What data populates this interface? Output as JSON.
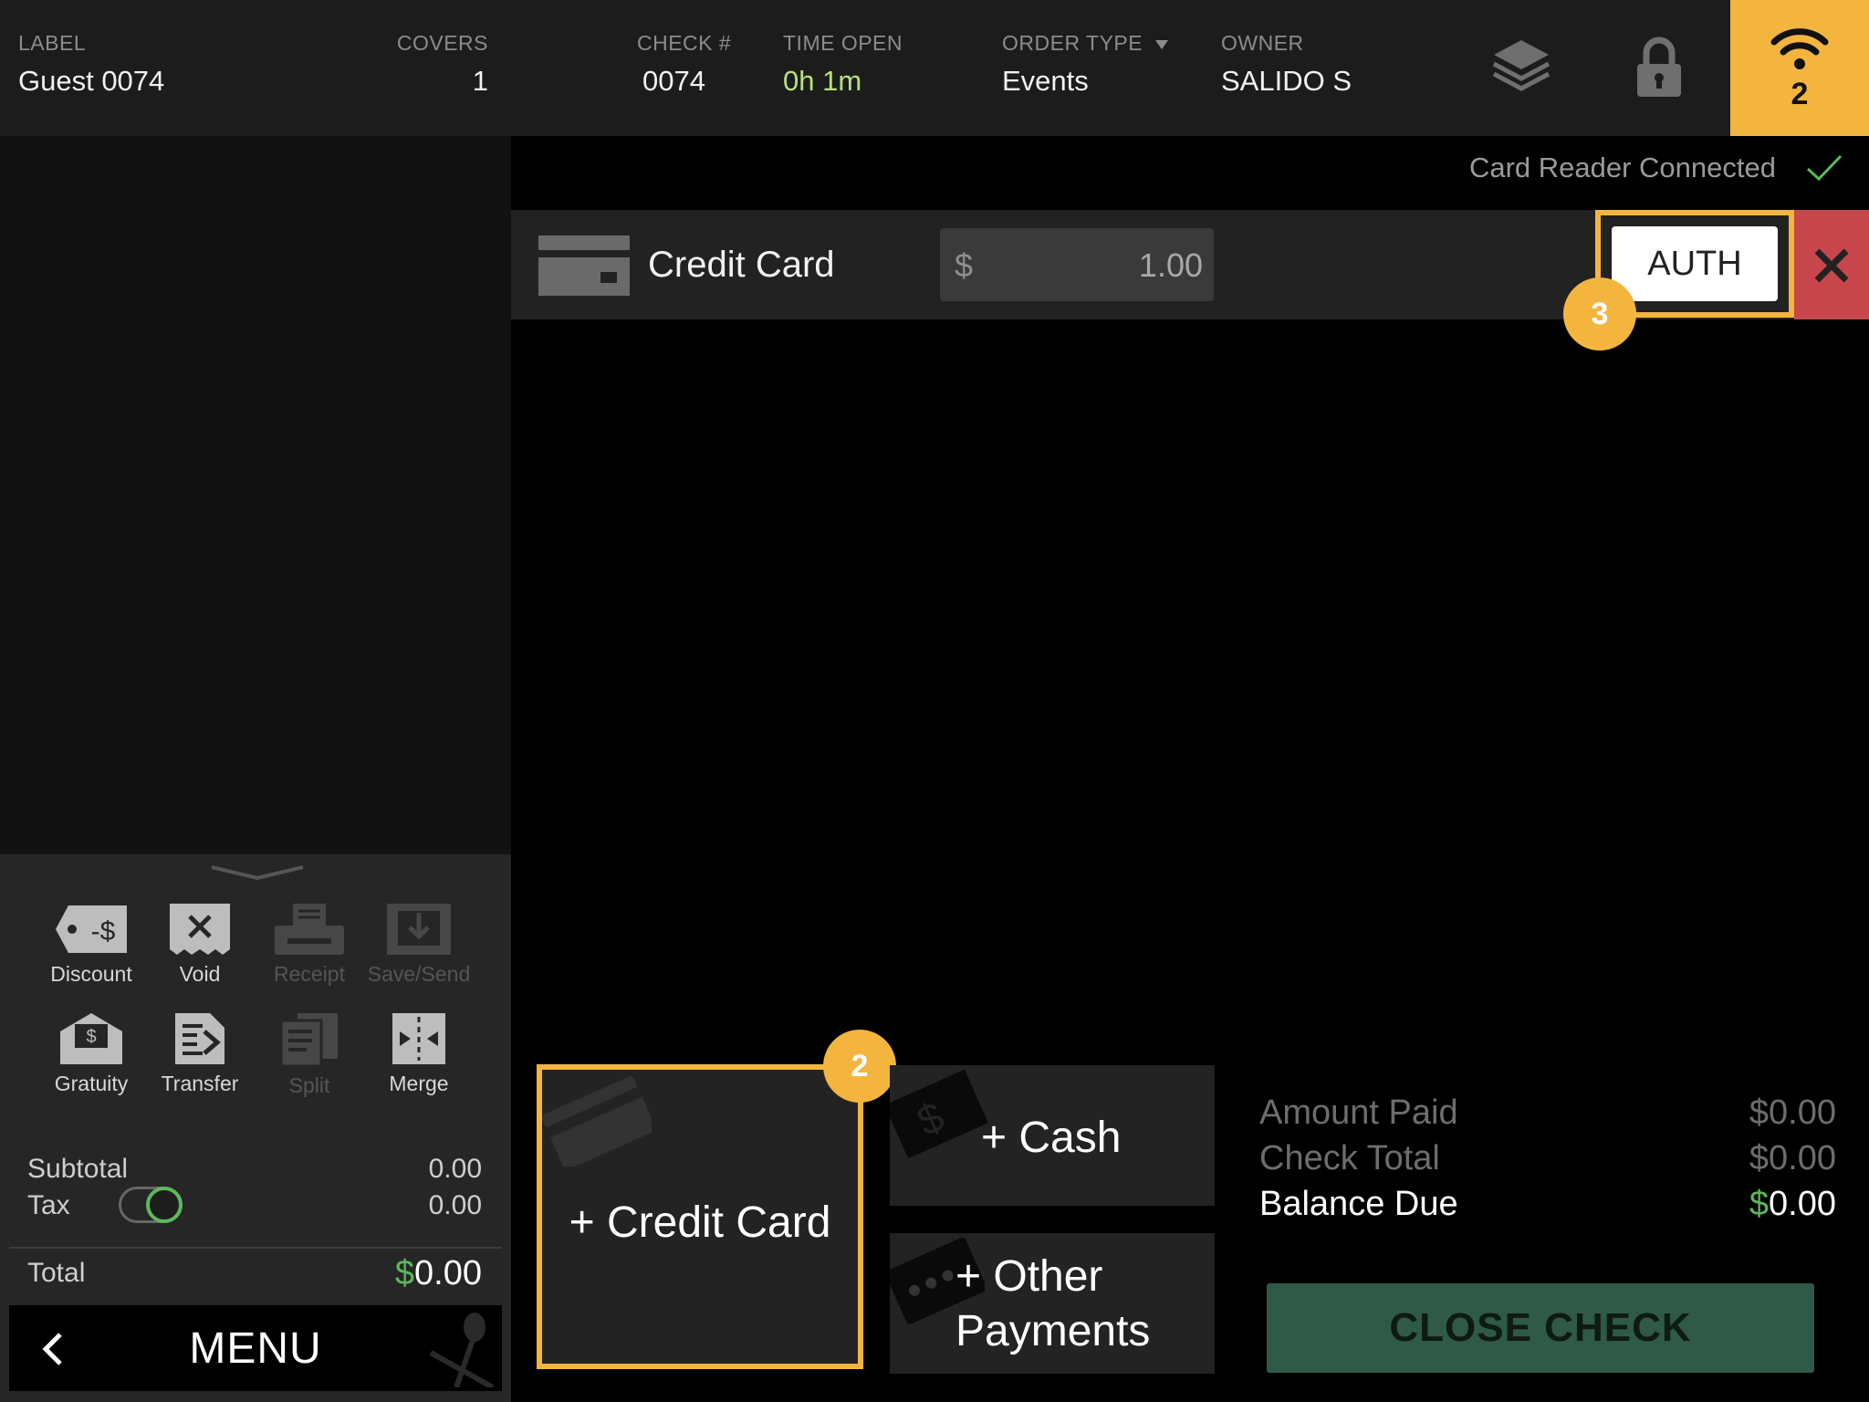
{
  "header": {
    "label": {
      "title": "LABEL",
      "value": "Guest 0074"
    },
    "covers": {
      "title": "COVERS",
      "value": "1"
    },
    "check": {
      "title": "CHECK #",
      "value": "0074"
    },
    "time_open": {
      "title": "TIME OPEN",
      "value": "0h 1m"
    },
    "order_type": {
      "title": "ORDER TYPE",
      "value": "Events"
    },
    "owner": {
      "title": "OWNER",
      "value": "SALIDO S"
    },
    "icons": [
      "layers-icon",
      "lock-icon",
      "wifi-icon"
    ],
    "wifi_count": "2"
  },
  "tools": [
    {
      "label": "Discount",
      "icon": "discount-tag-icon",
      "enabled": true
    },
    {
      "label": "Void",
      "icon": "void-receipt-icon",
      "enabled": true
    },
    {
      "label": "Receipt",
      "icon": "printer-icon",
      "enabled": false
    },
    {
      "label": "Save/Send",
      "icon": "save-send-icon",
      "enabled": false
    },
    {
      "label": "Gratuity",
      "icon": "gratuity-envelope-icon",
      "enabled": true
    },
    {
      "label": "Transfer",
      "icon": "transfer-icon",
      "enabled": true
    },
    {
      "label": "Split",
      "icon": "split-icon",
      "enabled": false
    },
    {
      "label": "Merge",
      "icon": "merge-icon",
      "enabled": true
    }
  ],
  "totals": {
    "subtotal_label": "Subtotal",
    "subtotal_value": "0.00",
    "tax_label": "Tax",
    "tax_value": "0.00",
    "tax_enabled": true,
    "total_label": "Total",
    "total_currency": "$",
    "total_value": "0.00"
  },
  "menu_label": "MENU",
  "status": {
    "text": "Card Reader Connected",
    "connected": true
  },
  "payment": {
    "method": "Credit Card",
    "currency": "$",
    "amount": "1.00",
    "auth_label": "AUTH"
  },
  "badges": {
    "auth": "3",
    "credit_card": "2"
  },
  "add_buttons": {
    "credit_card": "+ Credit Card",
    "cash": "+ Cash",
    "other_line1": "+ Other",
    "other_line2": "Payments"
  },
  "summary": {
    "amount_paid_label": "Amount Paid",
    "amount_paid": "$0.00",
    "check_total_label": "Check Total",
    "check_total": "$0.00",
    "balance_due_label": "Balance Due",
    "balance_currency": "$",
    "balance_due": "0.00"
  },
  "close_check_label": "CLOSE CHECK",
  "colors": {
    "accent": "#f4b53f",
    "positive": "#5cb85c",
    "danger": "#c8474c",
    "close_check": "#2e5a47"
  }
}
